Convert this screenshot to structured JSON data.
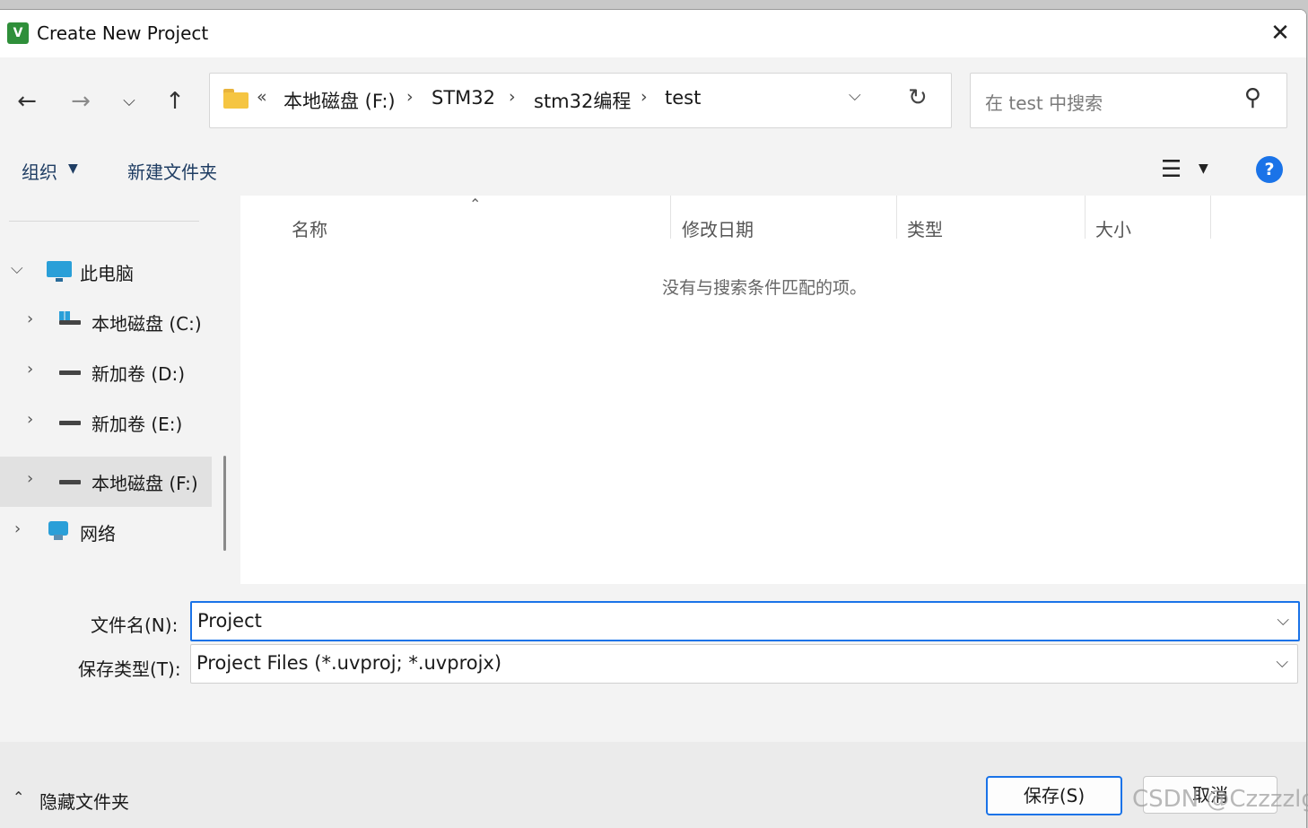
{
  "window": {
    "title": "Create New Project",
    "app_icon_text": "V"
  },
  "nav": {
    "breadcrumb_prefix": "«",
    "breadcrumbs": [
      "本地磁盘 (F:)",
      "STM32",
      "stm32编程",
      "test"
    ],
    "search_placeholder": "在 test 中搜索"
  },
  "toolbar": {
    "organize": "组织",
    "new_folder": "新建文件夹"
  },
  "sidebar": {
    "items": [
      {
        "label": "此电脑",
        "icon": "computer-icon",
        "expanded": true
      },
      {
        "label": "本地磁盘 (C:)",
        "icon": "system-drive-icon"
      },
      {
        "label": "新加卷 (D:)",
        "icon": "drive-icon"
      },
      {
        "label": "新加卷 (E:)",
        "icon": "drive-icon"
      },
      {
        "label": "本地磁盘 (F:)",
        "icon": "drive-icon",
        "selected": true
      },
      {
        "label": "网络",
        "icon": "network-icon"
      }
    ]
  },
  "file_list": {
    "columns": [
      "名称",
      "修改日期",
      "类型",
      "大小"
    ],
    "empty_message": "没有与搜索条件匹配的项。"
  },
  "form": {
    "filename_label": "文件名(N):",
    "filename_value": "Project",
    "savetype_label": "保存类型(T):",
    "savetype_value": "Project Files (*.uvproj; *.uvprojx)"
  },
  "footer": {
    "hide_folders": "隐藏文件夹",
    "save_button": "保存(S)",
    "cancel_button": "取消"
  },
  "watermark": "CSDN @Czzzzlg",
  "colors": {
    "accent": "#1a73e8",
    "folder": "#f5c542",
    "panel_bg": "#f3f3f3"
  }
}
